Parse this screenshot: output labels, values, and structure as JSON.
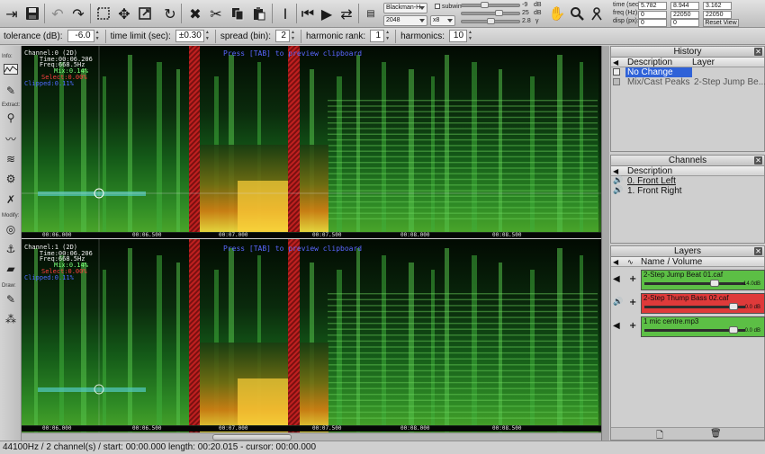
{
  "toolbar": {
    "window_type": "Blackman-H",
    "fft_size": "2048",
    "overlap": "x8",
    "subwin_label": "subwin",
    "db_min": "-9",
    "db_max": "25",
    "db_gamma": "2.8",
    "db_unit_1": "dB",
    "db_unit_2": "dB",
    "db_unit_3": "γ",
    "time_label": "time (sec):",
    "time_values": [
      "5.782",
      "8.944",
      "3.162"
    ],
    "freq_label": "freq (Hz):",
    "freq_values": [
      "0",
      "22050",
      "22050"
    ],
    "disp_label": "disp (px):",
    "disp_values": [
      "0",
      "0"
    ],
    "reset_view": "Reset View"
  },
  "options": {
    "tolerance_label": "tolerance (dB):",
    "tolerance_value": "-6.0",
    "time_limit_label": "time limit (sec):",
    "time_limit_value": "±0.30",
    "spread_label": "spread (bin):",
    "spread_value": "2",
    "harmonic_rank_label": "harmonic rank:",
    "harmonic_rank_value": "1",
    "harmonics_label": "harmonics:",
    "harmonics_value": "10"
  },
  "tools": {
    "info_label": "Info:",
    "extract_label": "Extract:",
    "modify_label": "Modify:",
    "draw_label": "Draw:"
  },
  "channels": [
    {
      "overlay_white": "Channel:0 (2D)\n    Time:00:06.206\n    Freq:668.5Hz",
      "mix": "Mix:0.14%",
      "select": "Select:0.00%",
      "clipped": "Clipped:0.11%",
      "hint": "Press [TAB] to preview clipboard"
    },
    {
      "overlay_white": "Channel:1 (2D)\n    Time:00:06.206\n    Freq:668.5Hz",
      "mix": "Mix:0.14%",
      "select": "Select:0.00%",
      "clipped": "Clipped:0.11%",
      "hint": "Press [TAB] to preview clipboard"
    }
  ],
  "time_labels": [
    "00:06.000",
    "00:06.500",
    "00:07.000",
    "00:07.500",
    "00:08.000",
    "00:08.500"
  ],
  "freq_labels": [
    "21000",
    "14000",
    "9000",
    "6000",
    "4000",
    "2000",
    "1000",
    "600",
    "300"
  ],
  "history": {
    "title": "History",
    "col_description": "Description",
    "col_layer": "Layer",
    "rows": [
      {
        "description": "No Change",
        "layer": ""
      },
      {
        "description": "Mix/Cast Peaks",
        "layer": "2-Step Jump Be..."
      }
    ]
  },
  "channels_panel": {
    "title": "Channels",
    "col_description": "Description",
    "rows": [
      "0. Front Left",
      "1. Front Right"
    ]
  },
  "layers": {
    "title": "Layers",
    "col_name": "Name / Volume",
    "rows": [
      {
        "name": "2-Step Jump Beat 01.caf",
        "db": "-14.0dB",
        "level": 0.7,
        "color": "#5cbf45"
      },
      {
        "name": "2-Step Thump Bass 02.caf",
        "db": "0.0 dB",
        "level": 0.9,
        "color": "#df3a3a"
      },
      {
        "name": "1 mic centre.mp3",
        "db": "0.0 dB",
        "level": 0.9,
        "color": "#5cbf45"
      }
    ]
  },
  "status": {
    "text": "44100Hz / 2 channel(s) / start: 00:00.000 length: 00:20.015 - cursor: 00:00.000"
  }
}
